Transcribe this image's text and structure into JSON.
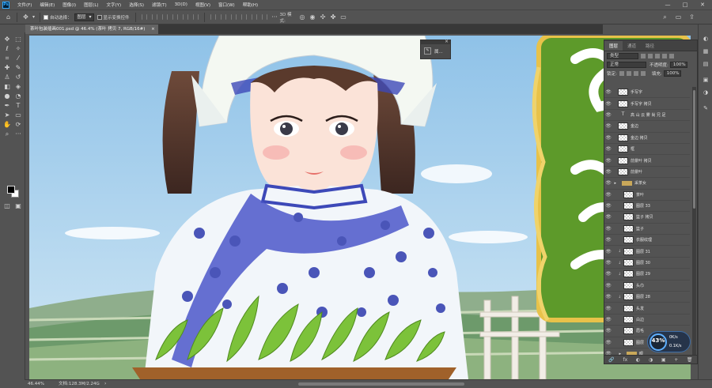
{
  "app": {
    "logo_text": "Ps"
  },
  "menu": [
    "文件(F)",
    "编辑(E)",
    "图像(I)",
    "图层(L)",
    "文字(Y)",
    "选择(S)",
    "滤镜(T)",
    "3D(D)",
    "视图(V)",
    "窗口(W)",
    "帮助(H)"
  ],
  "window_controls": [
    "—",
    "□",
    "✕"
  ],
  "options_bar": {
    "auto_select_label": "自动选择：",
    "auto_select_target": "图层",
    "show_transform_label": "显示变换控件"
  },
  "document": {
    "tab_title": "茶叶包装插画001.psd @ 46.4% (茶叶 拷贝 7, RGB/16#)",
    "zoom": "46.44%",
    "doc_info": "文档:128.3M/2.24G"
  },
  "float_panel": {
    "label": "属..."
  },
  "layers_panel": {
    "tabs": [
      "图层",
      "通道",
      "路径"
    ],
    "filter_kind": "类型",
    "blend_mode": "正常",
    "opacity_label": "不透明度:",
    "opacity_value": "100%",
    "lock_label": "锁定:",
    "fill_label": "填充:",
    "fill_value": "100%",
    "layers": [
      {
        "name": "手写字",
        "kind": "raster",
        "indent": 0
      },
      {
        "name": "手写字 拷贝",
        "kind": "raster",
        "indent": 0
      },
      {
        "name": "高 山 云 雾 尚 兄 足",
        "kind": "text",
        "indent": 0
      },
      {
        "name": "金边",
        "kind": "raster",
        "indent": 0
      },
      {
        "name": "金边 拷贝",
        "kind": "raster",
        "indent": 0
      },
      {
        "name": "框",
        "kind": "raster",
        "indent": 0
      },
      {
        "name": "前景叶 拷贝",
        "kind": "raster",
        "indent": 0
      },
      {
        "name": "前景叶",
        "kind": "raster",
        "indent": 0
      },
      {
        "name": "采茶女",
        "kind": "group",
        "indent": 0
      },
      {
        "name": "茶叶",
        "kind": "raster",
        "indent": 1
      },
      {
        "name": "图层 33",
        "kind": "raster",
        "indent": 1
      },
      {
        "name": "篮子 拷贝",
        "kind": "raster",
        "indent": 1
      },
      {
        "name": "篮子",
        "kind": "raster",
        "indent": 1
      },
      {
        "name": "衣服纹理",
        "kind": "raster",
        "indent": 1
      },
      {
        "name": "图层 31",
        "kind": "raster",
        "indent": 1,
        "clipped": true
      },
      {
        "name": "图层 30",
        "kind": "raster",
        "indent": 1,
        "clipped": true
      },
      {
        "name": "图层 29",
        "kind": "raster",
        "indent": 1,
        "clipped": true
      },
      {
        "name": "头巾",
        "kind": "raster",
        "indent": 1
      },
      {
        "name": "图层 28",
        "kind": "raster",
        "indent": 1,
        "clipped": true
      },
      {
        "name": "头发",
        "kind": "raster",
        "indent": 1
      },
      {
        "name": "白边",
        "kind": "raster",
        "indent": 1
      },
      {
        "name": "眉毛",
        "kind": "raster",
        "indent": 1
      },
      {
        "name": "图层",
        "kind": "raster",
        "indent": 1
      },
      {
        "name": "眼",
        "kind": "group",
        "indent": 1
      }
    ],
    "footer_icons": [
      "🔗",
      "fx",
      "◐",
      "◑",
      "▣",
      "+",
      "🗑"
    ]
  },
  "perf_widget": {
    "percent": "43%",
    "upload": "0K/s",
    "download": "0.1K/s"
  },
  "colors": {
    "ui_bg": "#535353",
    "panel_dark": "#3c3c3c",
    "sky": "#a7d1ee",
    "tea_green": "#5d9a2a",
    "gold": "#e8c24a",
    "porcelain_blue": "#3d49b8"
  }
}
